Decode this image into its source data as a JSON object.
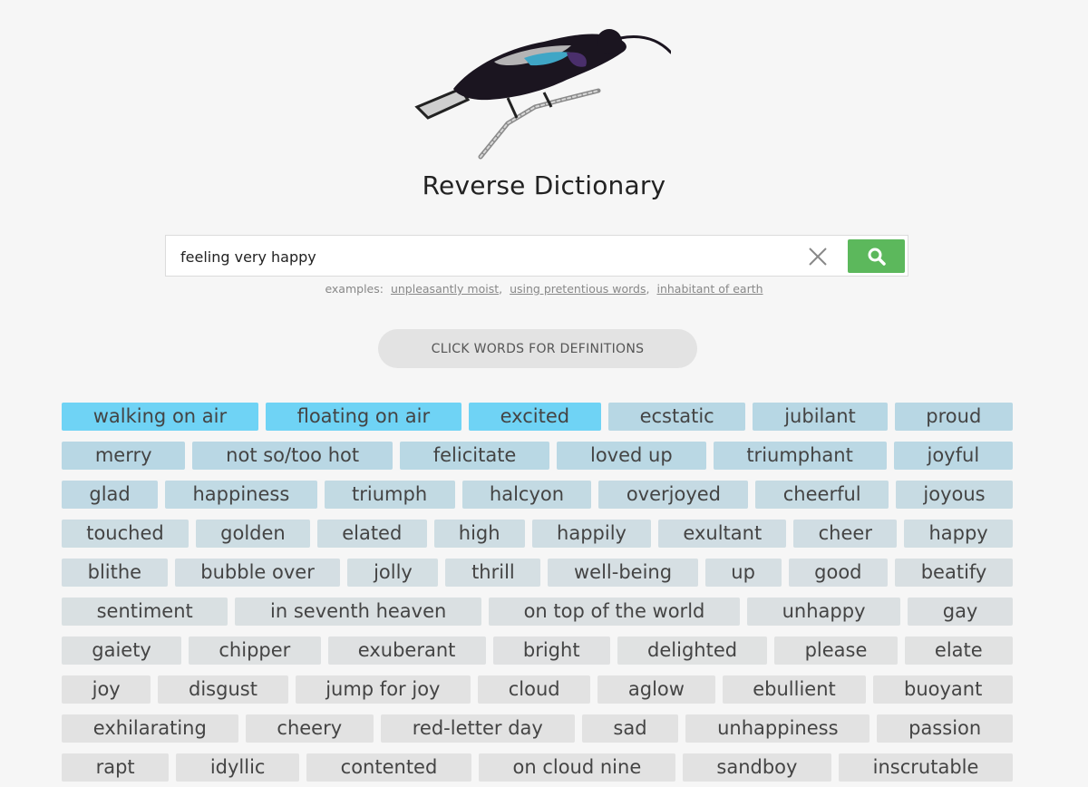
{
  "header": {
    "logo_icon": "sunbird-illustration-icon",
    "title": "Reverse Dictionary"
  },
  "search": {
    "value": "feeling very happy",
    "placeholder": "",
    "clear_icon": "close-icon",
    "submit_icon": "search-icon",
    "examples_label": "examples:",
    "examples": [
      "unpleasantly moist",
      "using pretentious words",
      "inhabitant of earth"
    ]
  },
  "definitions_button": {
    "label": "CLICK WORDS FOR DEFINITIONS"
  },
  "colors": {
    "most_relevant": "#6fd3f5",
    "relevant": "#b7d7e4",
    "least_relevant": "#e2e2e2",
    "search_button": "#5cb85c"
  },
  "results": {
    "rows": [
      [
        {
          "word": "walking on air",
          "relevance": 1.0
        },
        {
          "word": "floating on air",
          "relevance": 1.0
        },
        {
          "word": "excited",
          "relevance": 0.98
        },
        {
          "word": "ecstatic",
          "relevance": 0.8
        },
        {
          "word": "jubilant",
          "relevance": 0.8
        },
        {
          "word": "proud",
          "relevance": 0.79
        }
      ],
      [
        {
          "word": "merry",
          "relevance": 0.78
        },
        {
          "word": "not so/too hot",
          "relevance": 0.77
        },
        {
          "word": "felicitate",
          "relevance": 0.76
        },
        {
          "word": "loved up",
          "relevance": 0.75
        },
        {
          "word": "triumphant",
          "relevance": 0.74
        },
        {
          "word": "joyful",
          "relevance": 0.73
        }
      ],
      [
        {
          "word": "glad",
          "relevance": 0.66
        },
        {
          "word": "happiness",
          "relevance": 0.64
        },
        {
          "word": "triumph",
          "relevance": 0.62
        },
        {
          "word": "halcyon",
          "relevance": 0.6
        },
        {
          "word": "overjoyed",
          "relevance": 0.58
        },
        {
          "word": "cheerful",
          "relevance": 0.56
        },
        {
          "word": "joyous",
          "relevance": 0.54
        }
      ],
      [
        {
          "word": "touched",
          "relevance": 0.45
        },
        {
          "word": "golden",
          "relevance": 0.44
        },
        {
          "word": "elated",
          "relevance": 0.43
        },
        {
          "word": "high",
          "relevance": 0.42
        },
        {
          "word": "happily",
          "relevance": 0.41
        },
        {
          "word": "exultant",
          "relevance": 0.4
        },
        {
          "word": "cheer",
          "relevance": 0.39
        },
        {
          "word": "happy",
          "relevance": 0.38
        }
      ],
      [
        {
          "word": "blithe",
          "relevance": 0.34
        },
        {
          "word": "bubble over",
          "relevance": 0.33
        },
        {
          "word": "jolly",
          "relevance": 0.32
        },
        {
          "word": "thrill",
          "relevance": 0.31
        },
        {
          "word": "well-being",
          "relevance": 0.3
        },
        {
          "word": "up",
          "relevance": 0.29
        },
        {
          "word": "good",
          "relevance": 0.28
        },
        {
          "word": "beatify",
          "relevance": 0.27
        }
      ],
      [
        {
          "word": "sentiment",
          "relevance": 0.24
        },
        {
          "word": "in seventh heaven",
          "relevance": 0.23
        },
        {
          "word": "on top of the world",
          "relevance": 0.22
        },
        {
          "word": "unhappy",
          "relevance": 0.21
        },
        {
          "word": "gay",
          "relevance": 0.2
        }
      ],
      [
        {
          "word": "gaiety",
          "relevance": 0.17
        },
        {
          "word": "chipper",
          "relevance": 0.16
        },
        {
          "word": "exuberant",
          "relevance": 0.15
        },
        {
          "word": "bright",
          "relevance": 0.14
        },
        {
          "word": "delighted",
          "relevance": 0.13
        },
        {
          "word": "please",
          "relevance": 0.12
        },
        {
          "word": "elate",
          "relevance": 0.11
        }
      ],
      [
        {
          "word": "joy",
          "relevance": 0.09
        },
        {
          "word": "disgust",
          "relevance": 0.08
        },
        {
          "word": "jump for joy",
          "relevance": 0.07
        },
        {
          "word": "cloud",
          "relevance": 0.06
        },
        {
          "word": "aglow",
          "relevance": 0.05
        },
        {
          "word": "ebullient",
          "relevance": 0.05
        },
        {
          "word": "buoyant",
          "relevance": 0.04
        }
      ],
      [
        {
          "word": "exhilarating",
          "relevance": 0.03
        },
        {
          "word": "cheery",
          "relevance": 0.03
        },
        {
          "word": "red-letter day",
          "relevance": 0.02
        },
        {
          "word": "sad",
          "relevance": 0.02
        },
        {
          "word": "unhappiness",
          "relevance": 0.02
        },
        {
          "word": "passion",
          "relevance": 0.01
        }
      ],
      [
        {
          "word": "rapt",
          "relevance": 0.01
        },
        {
          "word": "idyllic",
          "relevance": 0.0
        },
        {
          "word": "contented",
          "relevance": 0.0
        },
        {
          "word": "on cloud nine",
          "relevance": 0.0
        },
        {
          "word": "sandboy",
          "relevance": 0.0
        },
        {
          "word": "inscrutable",
          "relevance": 0.0
        }
      ]
    ]
  }
}
